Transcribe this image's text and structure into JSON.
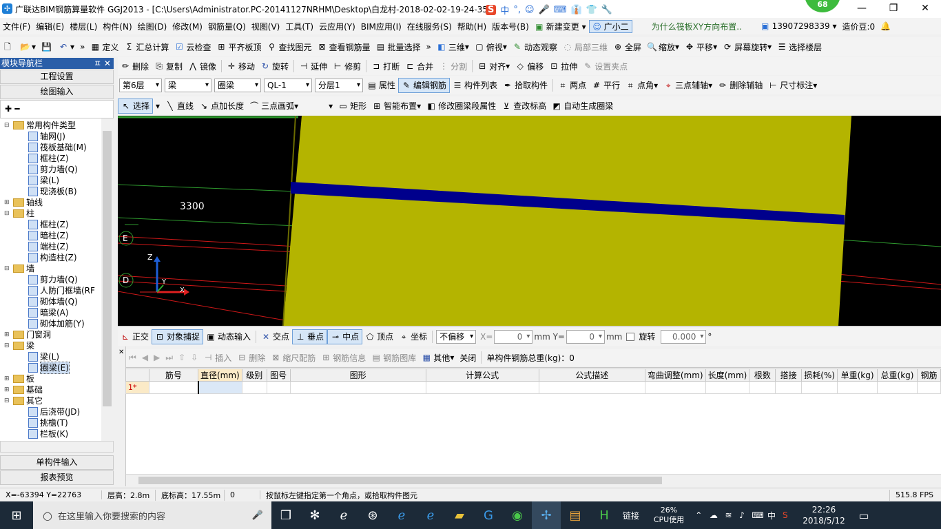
{
  "app": {
    "title": "广联达BIM钢筋算量软件 GGJ2013 - [C:\\Users\\Administrator.PC-20141127NRHM\\Desktop\\白龙村-2018-02-02-19-24-35",
    "badge": "68",
    "ime": [
      "S",
      "中",
      "°,",
      "☺",
      "🎤",
      "⌨",
      "👔",
      "👕",
      "🔧"
    ]
  },
  "menu": [
    "文件(F)",
    "编辑(E)",
    "楼层(L)",
    "构件(N)",
    "绘图(D)",
    "修改(M)",
    "钢筋量(Q)",
    "视图(V)",
    "工具(T)",
    "云应用(Y)",
    "BIM应用(I)",
    "在线服务(S)",
    "帮助(H)",
    "版本号(B)",
    "新建变更",
    "广小二"
  ],
  "menu_right": {
    "question": "为什么筏板XY方向布置..",
    "phone": "13907298339",
    "price_bean": "造价豆:0"
  },
  "toolbar1": [
    "定义",
    "汇总计算",
    "云检查",
    "平齐板顶",
    "查找图元",
    "查看钢筋量",
    "批量选择",
    "三维",
    "俯视",
    "动态观察",
    "局部三维",
    "全屏",
    "缩放",
    "平移",
    "屏幕旋转",
    "选择楼层"
  ],
  "left": {
    "title": "模块导航栏",
    "pin": "ㅍ ✕",
    "btn_project": "工程设置",
    "btn_draw": "绘图输入",
    "btn_single": "单构件输入",
    "btn_report": "报表预览",
    "tree": [
      {
        "label": "常用构件类型",
        "level": 0,
        "kind": "folder",
        "exp": "⊟"
      },
      {
        "label": "轴网(J)",
        "level": 1,
        "kind": "comp"
      },
      {
        "label": "筏板基础(M)",
        "level": 1,
        "kind": "comp"
      },
      {
        "label": "框柱(Z)",
        "level": 1,
        "kind": "comp"
      },
      {
        "label": "剪力墙(Q)",
        "level": 1,
        "kind": "comp"
      },
      {
        "label": "梁(L)",
        "level": 1,
        "kind": "comp"
      },
      {
        "label": "现浇板(B)",
        "level": 1,
        "kind": "comp"
      },
      {
        "label": "轴线",
        "level": 0,
        "kind": "folder",
        "exp": "⊞"
      },
      {
        "label": "柱",
        "level": 0,
        "kind": "folder",
        "exp": "⊟"
      },
      {
        "label": "框柱(Z)",
        "level": 1,
        "kind": "comp"
      },
      {
        "label": "暗柱(Z)",
        "level": 1,
        "kind": "comp"
      },
      {
        "label": "端柱(Z)",
        "level": 1,
        "kind": "comp"
      },
      {
        "label": "构造柱(Z)",
        "level": 1,
        "kind": "comp"
      },
      {
        "label": "墙",
        "level": 0,
        "kind": "folder",
        "exp": "⊟"
      },
      {
        "label": "剪力墙(Q)",
        "level": 1,
        "kind": "comp"
      },
      {
        "label": "人防门框墙(RF",
        "level": 1,
        "kind": "comp"
      },
      {
        "label": "砌体墙(Q)",
        "level": 1,
        "kind": "comp"
      },
      {
        "label": "暗梁(A)",
        "level": 1,
        "kind": "comp"
      },
      {
        "label": "砌体加筋(Y)",
        "level": 1,
        "kind": "comp"
      },
      {
        "label": "门窗洞",
        "level": 0,
        "kind": "folder",
        "exp": "⊞"
      },
      {
        "label": "梁",
        "level": 0,
        "kind": "folder",
        "exp": "⊟"
      },
      {
        "label": "梁(L)",
        "level": 1,
        "kind": "comp"
      },
      {
        "label": "圈梁(E)",
        "level": 1,
        "kind": "comp",
        "selected": true
      },
      {
        "label": "板",
        "level": 0,
        "kind": "folder",
        "exp": "⊞"
      },
      {
        "label": "基础",
        "level": 0,
        "kind": "folder",
        "exp": "⊞"
      },
      {
        "label": "其它",
        "level": 0,
        "kind": "folder",
        "exp": "⊟"
      },
      {
        "label": "后浇带(JD)",
        "level": 1,
        "kind": "comp"
      },
      {
        "label": "挑檐(T)",
        "level": 1,
        "kind": "comp"
      },
      {
        "label": "栏板(K)",
        "level": 1,
        "kind": "comp"
      }
    ]
  },
  "toolbar2": [
    "删除",
    "复制",
    "镜像",
    "移动",
    "旋转",
    "延伸",
    "修剪",
    "打断",
    "合并",
    "分割",
    "对齐",
    "偏移",
    "拉伸",
    "设置夹点"
  ],
  "toolbar3": {
    "floor": "第6层",
    "type": "梁",
    "subtype": "圈梁",
    "name": "QL-1",
    "layer": "分层1",
    "buttons": [
      "属性",
      "编辑钢筋",
      "构件列表",
      "拾取构件",
      "两点",
      "平行",
      "点角",
      "三点辅轴",
      "删除辅轴",
      "尺寸标注"
    ]
  },
  "toolbar4": [
    "选择",
    "直线",
    "点加长度",
    "三点画弧",
    "矩形",
    "智能布置",
    "修改圈梁段属性",
    "查改标高",
    "自动生成圈梁"
  ],
  "canvas": {
    "dim_label": "3300",
    "axis_e": "E",
    "axis_d": "D",
    "z_label": "Z",
    "x_label": "X",
    "y_label": "Y"
  },
  "snapbar": {
    "items": [
      "正交",
      "对象捕捉",
      "动态输入",
      "交点",
      "垂点",
      "中点",
      "顶点",
      "坐标"
    ],
    "offset_mode": "不偏移",
    "x_label": "X=",
    "x_value": "0",
    "y_label": "mm Y=",
    "y_value": "0",
    "mm": "mm",
    "rotate_label": "旋转",
    "rotate_value": "0.000",
    "deg": "°"
  },
  "rebar_toolbar": [
    "插入",
    "删除",
    "缩尺配筋",
    "钢筋信息",
    "钢筋图库",
    "其他",
    "关闭"
  ],
  "rebar_total": "单构件钢筋总重(kg)：0",
  "rebar_table": {
    "headers": [
      "筋号",
      "直径(mm)",
      "级别",
      "图号",
      "图形",
      "计算公式",
      "公式描述",
      "弯曲调整(mm)",
      "长度(mm)",
      "根数",
      "搭接",
      "损耗(%)",
      "单重(kg)",
      "总重(kg)",
      "钢筋"
    ],
    "rows": [
      [
        "1*",
        "",
        "",
        "",
        "",
        "",
        "",
        "",
        "",
        "",
        "",
        "",
        "",
        "",
        ""
      ]
    ]
  },
  "status": {
    "coords": "X=-63394 Y=22763",
    "floor_height": "层高：2.8m",
    "base_height": "底标高：17.55m",
    "value": "0",
    "hint": "按鼠标左键指定第一个角点，或拾取构件图元",
    "fps": "515.8 FPS"
  },
  "taskbar": {
    "search_placeholder": "在这里输入你要搜索的内容",
    "link": "链接",
    "cpu_percent": "26%",
    "cpu_label": "CPU使用",
    "lang": "中",
    "time": "22:26",
    "date": "2018/5/12"
  },
  "colors": {
    "slab": "#b4b400",
    "beam": "#00008c",
    "canvas_bg": "#000000",
    "axis_green": "#2e9a2e",
    "axis_red": "#d01818"
  }
}
